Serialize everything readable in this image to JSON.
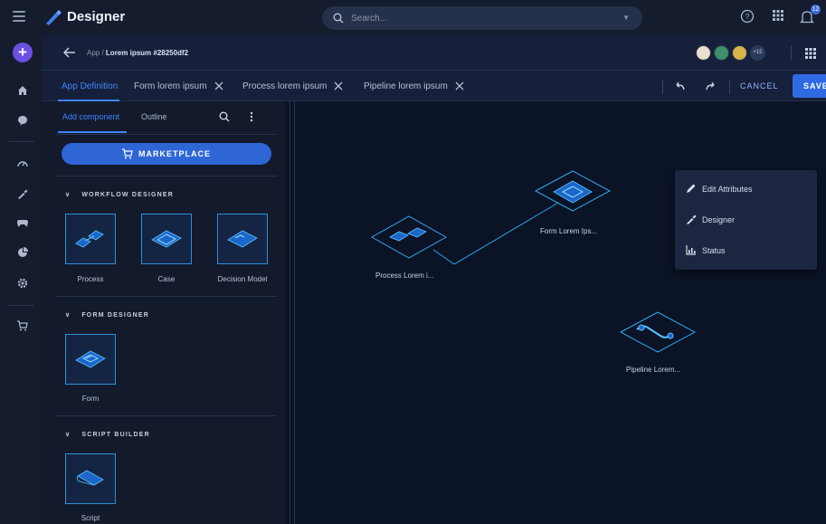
{
  "app": {
    "title": "Designer"
  },
  "search": {
    "placeholder": "Search..."
  },
  "notifications": {
    "count": "12"
  },
  "breadcrumb": {
    "parent": "App /",
    "current": "Lorem ipsum #28250df2"
  },
  "avatars": {
    "more_label": "+15"
  },
  "tabs": [
    {
      "label": "App Definition"
    },
    {
      "label": "Form lorem ipsum"
    },
    {
      "label": "Process lorem ipsum"
    },
    {
      "label": "Pipeline lorem ipsum"
    }
  ],
  "actions": {
    "cancel": "CANCEL",
    "save": "SAVE"
  },
  "panel": {
    "tabs": [
      {
        "label": "Add component"
      },
      {
        "label": "Outline"
      }
    ],
    "marketplace_label": "MARKETPLACE",
    "sections": [
      {
        "title": "WORKFLOW DESIGNER",
        "items": [
          {
            "label": "Process"
          },
          {
            "label": "Case"
          },
          {
            "label": "Decision Model"
          }
        ]
      },
      {
        "title": "FORM DESIGNER",
        "items": [
          {
            "label": "Form"
          }
        ]
      },
      {
        "title": "SCRIPT BUILDER",
        "items": [
          {
            "label": "Script"
          }
        ]
      }
    ]
  },
  "canvas": {
    "nodes": [
      {
        "label": "Process Lorem i..."
      },
      {
        "label": "Form Lorem Ips..."
      },
      {
        "label": "Pipeline Lorem..."
      }
    ]
  },
  "context_menu": {
    "items": [
      {
        "label": "Edit Attributes"
      },
      {
        "label": "Designer"
      },
      {
        "label": "Status"
      }
    ]
  },
  "colors": {
    "accent": "#3f86ff",
    "node_stroke": "#2fa8e8",
    "save": "#2f6ae3",
    "background": "#0b1326"
  }
}
